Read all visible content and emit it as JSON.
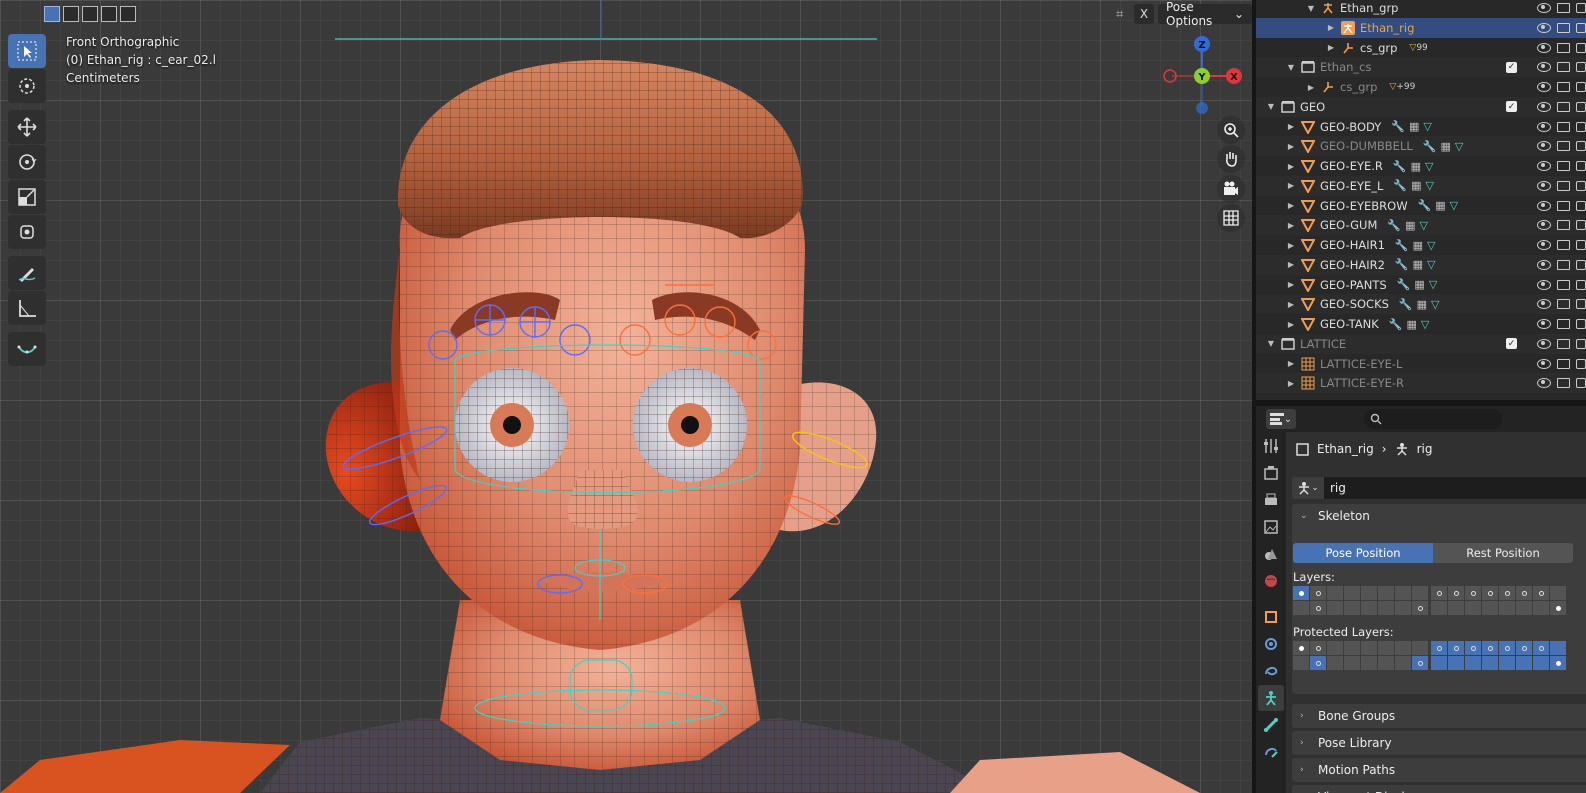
{
  "viewport": {
    "view_name": "Front Orthographic",
    "active_item": "(0) Ethan_rig : c_ear_02.l",
    "units": "Centimeters",
    "x_button": "X",
    "pose_options": "Pose Options",
    "gizmo": {
      "z": "Z",
      "y": "Y",
      "x": "X"
    }
  },
  "outliner": {
    "rows": [
      {
        "name": "Ethan_grp",
        "type": "armature-group",
        "expanded": true,
        "indent": 1
      },
      {
        "name": "Ethan_rig",
        "type": "armature",
        "selected": true,
        "indent": 2
      },
      {
        "name": "cs_grp",
        "type": "empty",
        "badge": "99",
        "indent": 2
      },
      {
        "name": "Ethan_cs",
        "type": "collection",
        "dim": true,
        "indent": 0
      },
      {
        "name": "cs_grp",
        "type": "empty",
        "badge": "+99",
        "dim": true,
        "indent": 1
      },
      {
        "name": "GEO",
        "type": "collection",
        "indent": -1
      },
      {
        "name": "GEO-BODY",
        "type": "mesh",
        "indent": 0
      },
      {
        "name": "GEO-DUMBBELL",
        "type": "mesh",
        "dim": true,
        "indent": 0
      },
      {
        "name": "GEO-EYE.R",
        "type": "mesh",
        "indent": 0
      },
      {
        "name": "GEO-EYE_L",
        "type": "mesh",
        "indent": 0
      },
      {
        "name": "GEO-EYEBROW",
        "type": "mesh",
        "indent": 0
      },
      {
        "name": "GEO-GUM",
        "type": "mesh",
        "indent": 0
      },
      {
        "name": "GEO-HAIR1",
        "type": "mesh",
        "indent": 0
      },
      {
        "name": "GEO-HAIR2",
        "type": "mesh",
        "indent": 0
      },
      {
        "name": "GEO-PANTS",
        "type": "mesh",
        "indent": 0
      },
      {
        "name": "GEO-SOCKS",
        "type": "mesh",
        "indent": 0
      },
      {
        "name": "GEO-TANK",
        "type": "mesh",
        "indent": 0
      },
      {
        "name": "LATTICE",
        "type": "collection",
        "dim": true,
        "indent": -1
      },
      {
        "name": "LATTICE-EYE-L",
        "type": "lattice",
        "dim": true,
        "indent": 0
      },
      {
        "name": "LATTICE-EYE-R",
        "type": "lattice",
        "dim": true,
        "indent": 0
      }
    ]
  },
  "properties": {
    "breadcrumb_object": "Ethan_rig",
    "breadcrumb_data": "rig",
    "datablock_name": "rig",
    "skeleton_label": "Skeleton",
    "pose_position": "Pose Position",
    "rest_position": "Rest Position",
    "layers_label": "Layers:",
    "protected_layers_label": "Protected Layers:",
    "collapsed_panels": [
      "Bone Groups",
      "Pose Library",
      "Motion Paths",
      "Viewport Display"
    ]
  },
  "colors": {
    "accent": "#4772b3",
    "selection_row": "#334d80",
    "active_name": "#f0a243",
    "object_orange": "#f29d50",
    "bone_blue": "#5a6cff",
    "bone_orange": "#ff6e3a",
    "bone_cyan": "#3cd4c8"
  }
}
